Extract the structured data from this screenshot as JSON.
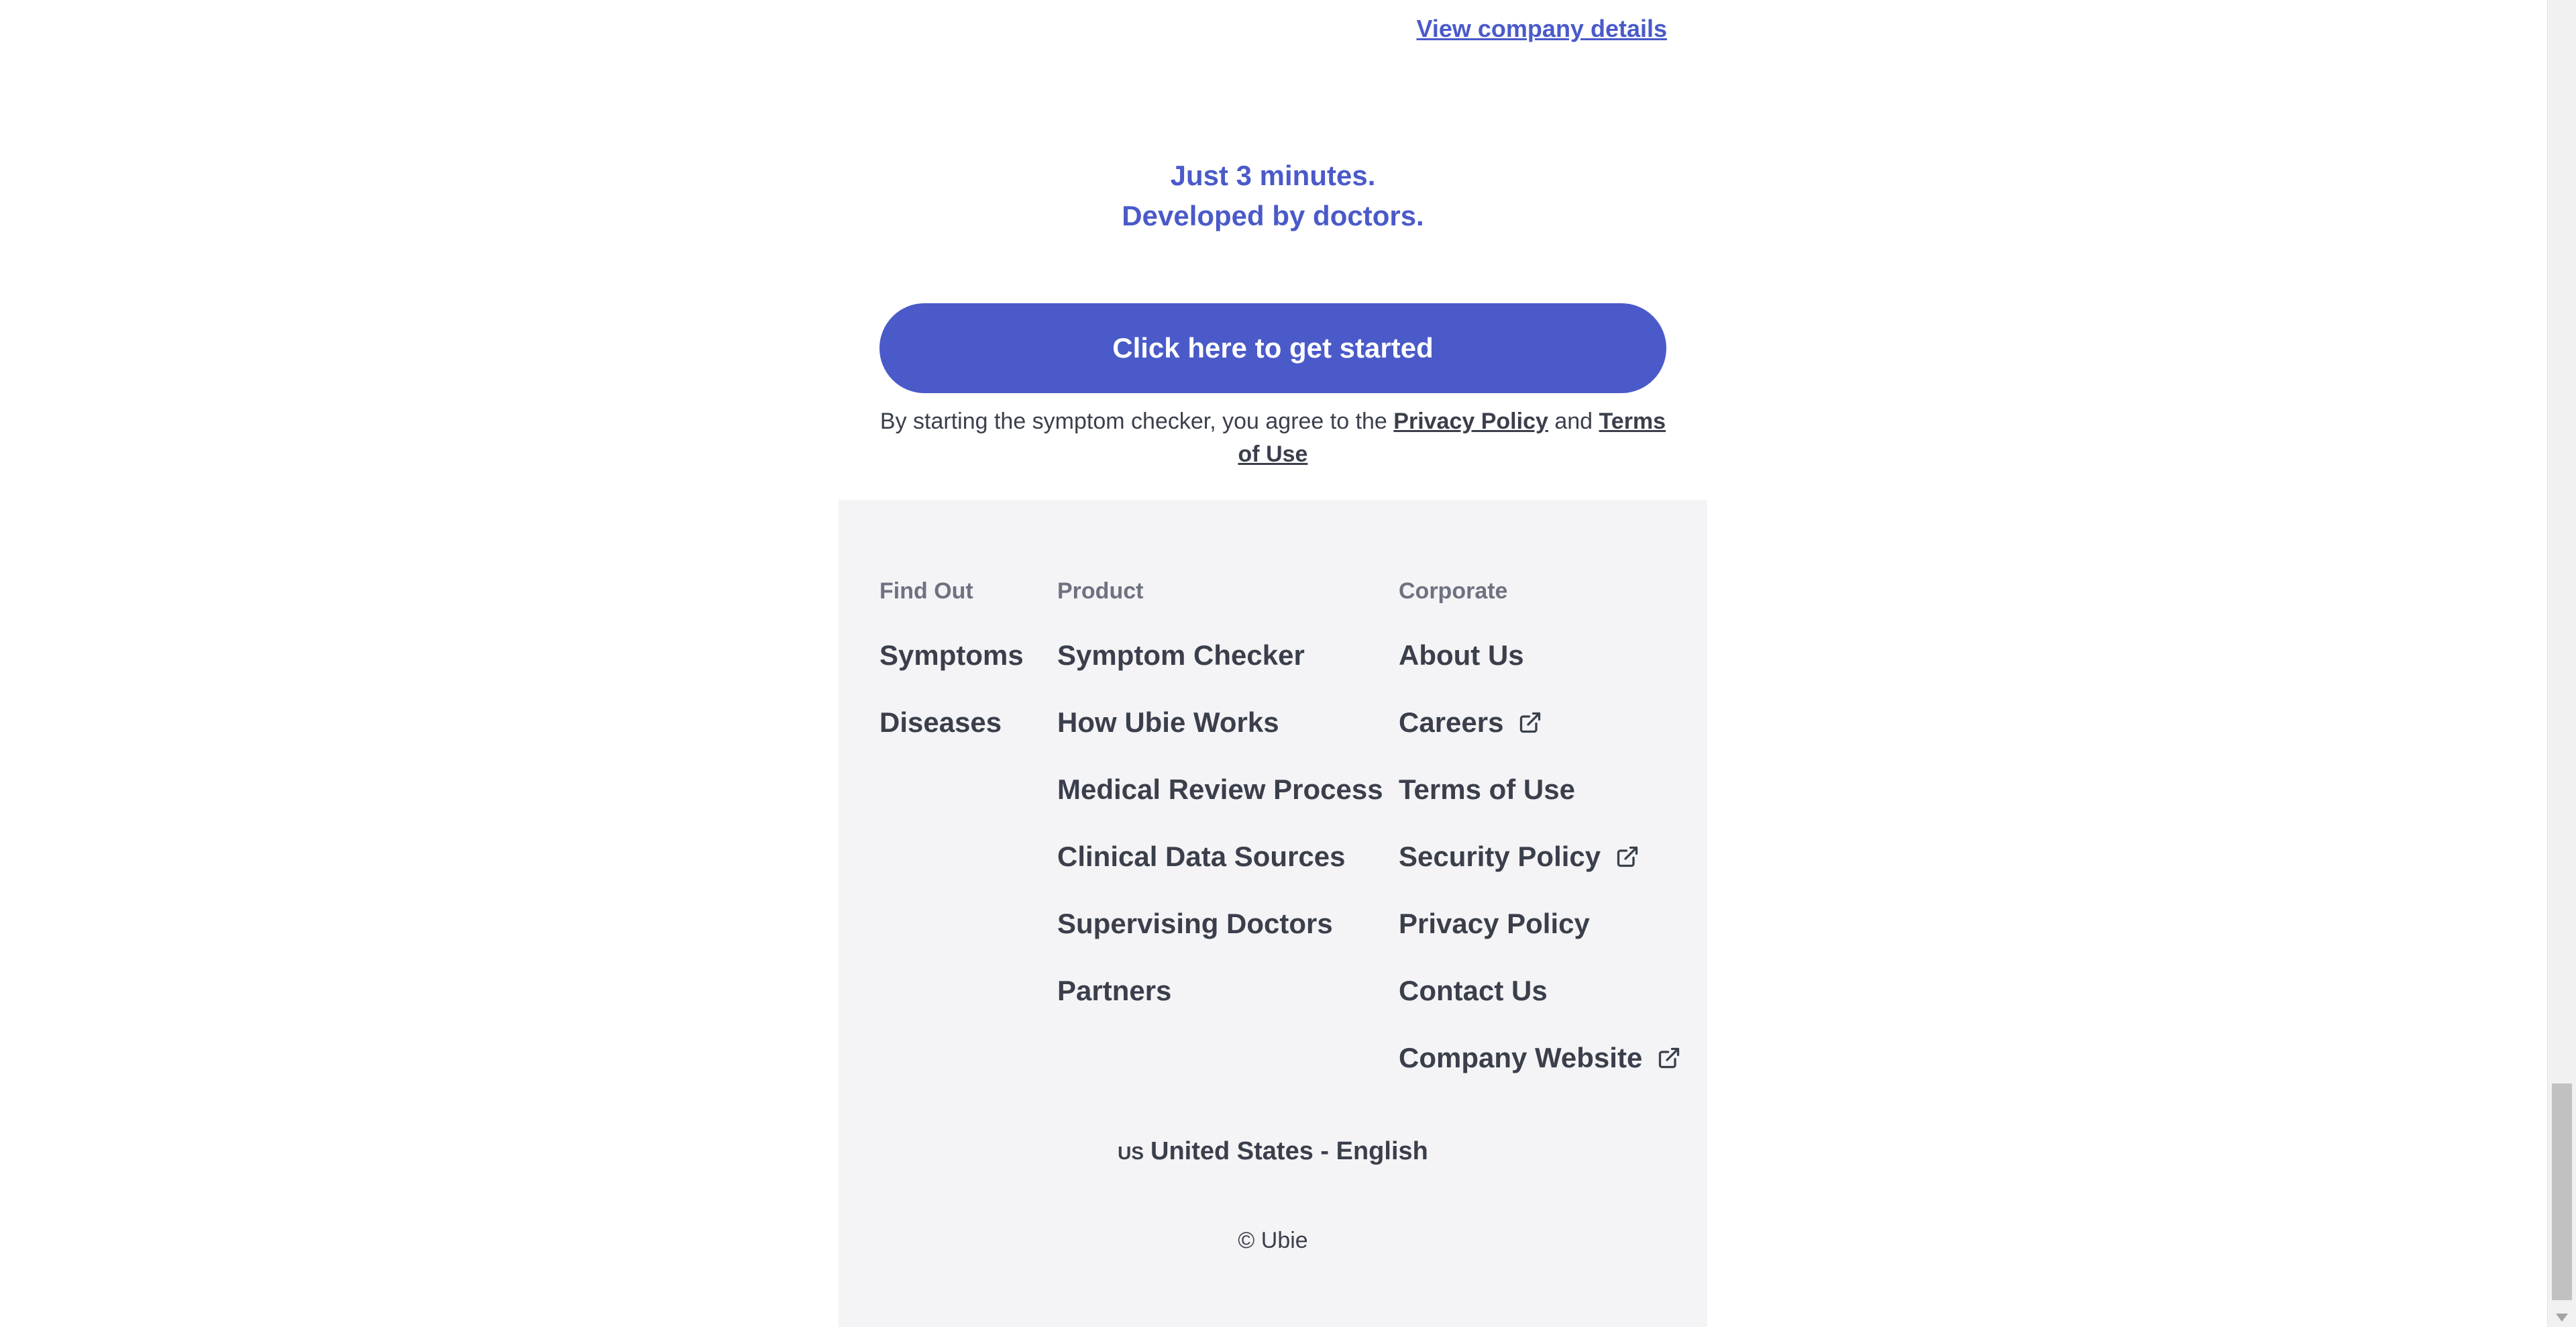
{
  "top_link": "View company details",
  "tagline": {
    "line1": "Just 3 minutes.",
    "line2": "Developed by doctors."
  },
  "cta_label": "Click here to get started",
  "consent": {
    "prefix": "By starting the symptom checker, you agree to the",
    "privacy": "Privacy Policy",
    "and": "and",
    "terms": "Terms of Use"
  },
  "footer": {
    "find_out": {
      "heading": "Find Out",
      "items": [
        "Symptoms",
        "Diseases"
      ]
    },
    "product": {
      "heading": "Product",
      "items": [
        "Symptom Checker",
        "How Ubie Works",
        "Medical Review Process",
        "Clinical Data Sources",
        "Supervising Doctors",
        "Partners"
      ]
    },
    "corporate": {
      "heading": "Corporate",
      "items": [
        {
          "label": "About Us",
          "external": false
        },
        {
          "label": "Careers",
          "external": true
        },
        {
          "label": "Terms of Use",
          "external": false
        },
        {
          "label": "Security Policy",
          "external": true
        },
        {
          "label": "Privacy Policy",
          "external": false
        },
        {
          "label": "Contact Us",
          "external": false
        },
        {
          "label": "Company Website",
          "external": true
        }
      ]
    },
    "locale": {
      "country_code": "US",
      "label": "United States - English"
    },
    "copyright": "© Ubie"
  },
  "colors": {
    "accent": "#4a5ac9",
    "text": "#3a3f4b",
    "muted": "#6e7280",
    "footer_bg": "#f4f4f6"
  },
  "icons": {
    "external": "external-link-icon"
  }
}
